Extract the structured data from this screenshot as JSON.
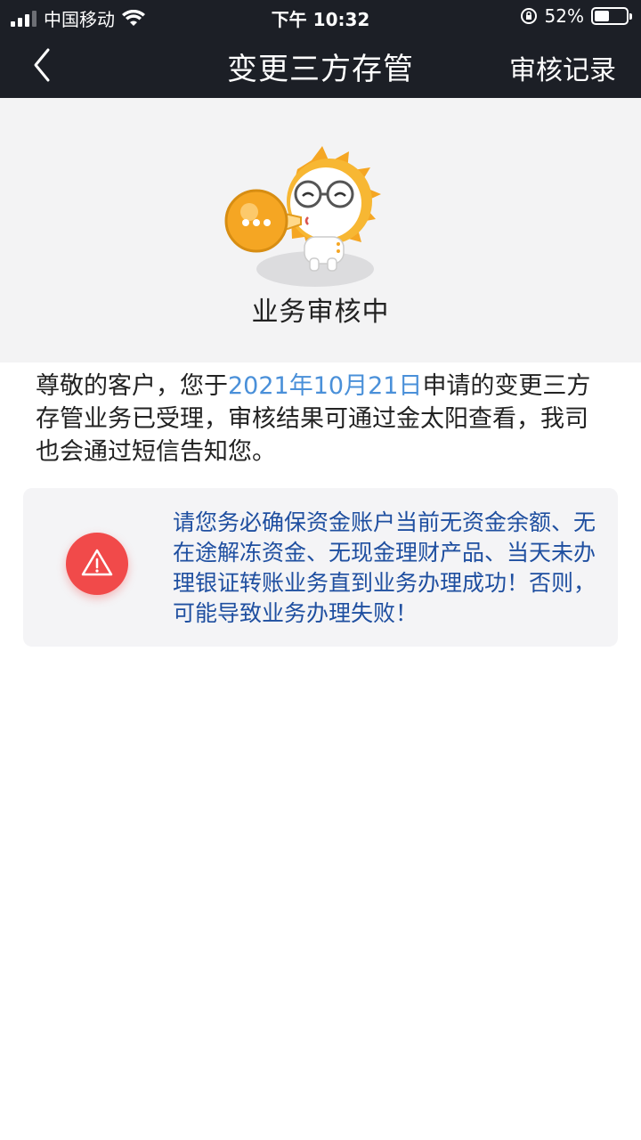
{
  "status_bar": {
    "carrier": "中国移动",
    "time": "下午 10:32",
    "battery_percent": "52%",
    "battery_level": 0.52
  },
  "nav": {
    "title": "变更三方存管",
    "right_action": "审核记录"
  },
  "hero": {
    "status_text": "业务审核中"
  },
  "notice": {
    "prefix": "尊敬的客户，您于",
    "date": "2021年10月21日",
    "suffix": "申请的变更三方存管业务已受理，审核结果可通过金太阳查看，我司也会通过短信告知您。"
  },
  "warning": {
    "text": "请您务必确保资金账户当前无资金余额、无在途解冻资金、无现金理财产品、当天未办理银证转账业务直到业务办理成功！否则，可能导致业务办理失败！"
  },
  "colors": {
    "topbar_bg": "#1c1f26",
    "date_link": "#4a90d9",
    "warning_text": "#1f4fa0",
    "warning_icon_bg": "#f14a4a"
  }
}
